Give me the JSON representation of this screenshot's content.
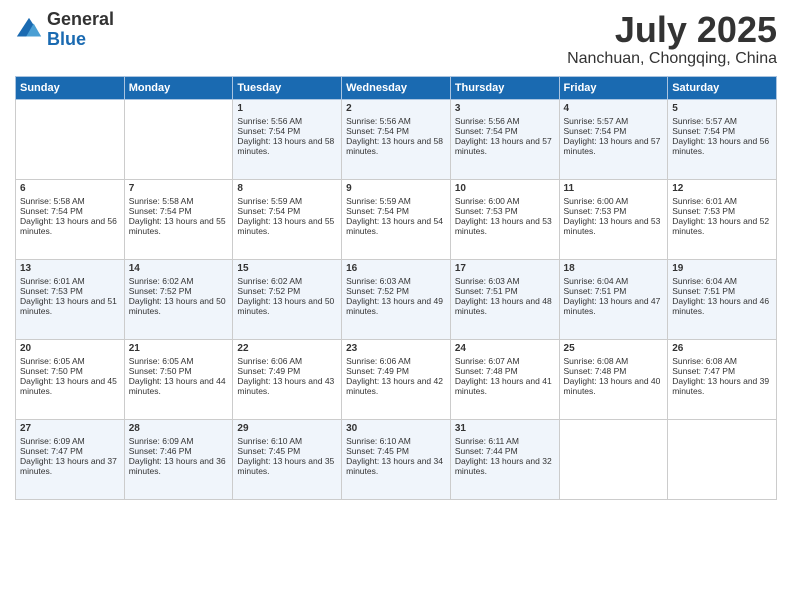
{
  "header": {
    "logo": {
      "general": "General",
      "blue": "Blue"
    },
    "title": "July 2025",
    "location": "Nanchuan, Chongqing, China"
  },
  "days_of_week": [
    "Sunday",
    "Monday",
    "Tuesday",
    "Wednesday",
    "Thursday",
    "Friday",
    "Saturday"
  ],
  "weeks": [
    [
      {
        "day": "",
        "empty": true
      },
      {
        "day": "",
        "empty": true
      },
      {
        "day": "1",
        "sunrise": "Sunrise: 5:56 AM",
        "sunset": "Sunset: 7:54 PM",
        "daylight": "Daylight: 13 hours and 58 minutes."
      },
      {
        "day": "2",
        "sunrise": "Sunrise: 5:56 AM",
        "sunset": "Sunset: 7:54 PM",
        "daylight": "Daylight: 13 hours and 58 minutes."
      },
      {
        "day": "3",
        "sunrise": "Sunrise: 5:56 AM",
        "sunset": "Sunset: 7:54 PM",
        "daylight": "Daylight: 13 hours and 57 minutes."
      },
      {
        "day": "4",
        "sunrise": "Sunrise: 5:57 AM",
        "sunset": "Sunset: 7:54 PM",
        "daylight": "Daylight: 13 hours and 57 minutes."
      },
      {
        "day": "5",
        "sunrise": "Sunrise: 5:57 AM",
        "sunset": "Sunset: 7:54 PM",
        "daylight": "Daylight: 13 hours and 56 minutes."
      }
    ],
    [
      {
        "day": "6",
        "sunrise": "Sunrise: 5:58 AM",
        "sunset": "Sunset: 7:54 PM",
        "daylight": "Daylight: 13 hours and 56 minutes."
      },
      {
        "day": "7",
        "sunrise": "Sunrise: 5:58 AM",
        "sunset": "Sunset: 7:54 PM",
        "daylight": "Daylight: 13 hours and 55 minutes."
      },
      {
        "day": "8",
        "sunrise": "Sunrise: 5:59 AM",
        "sunset": "Sunset: 7:54 PM",
        "daylight": "Daylight: 13 hours and 55 minutes."
      },
      {
        "day": "9",
        "sunrise": "Sunrise: 5:59 AM",
        "sunset": "Sunset: 7:54 PM",
        "daylight": "Daylight: 13 hours and 54 minutes."
      },
      {
        "day": "10",
        "sunrise": "Sunrise: 6:00 AM",
        "sunset": "Sunset: 7:53 PM",
        "daylight": "Daylight: 13 hours and 53 minutes."
      },
      {
        "day": "11",
        "sunrise": "Sunrise: 6:00 AM",
        "sunset": "Sunset: 7:53 PM",
        "daylight": "Daylight: 13 hours and 53 minutes."
      },
      {
        "day": "12",
        "sunrise": "Sunrise: 6:01 AM",
        "sunset": "Sunset: 7:53 PM",
        "daylight": "Daylight: 13 hours and 52 minutes."
      }
    ],
    [
      {
        "day": "13",
        "sunrise": "Sunrise: 6:01 AM",
        "sunset": "Sunset: 7:53 PM",
        "daylight": "Daylight: 13 hours and 51 minutes."
      },
      {
        "day": "14",
        "sunrise": "Sunrise: 6:02 AM",
        "sunset": "Sunset: 7:52 PM",
        "daylight": "Daylight: 13 hours and 50 minutes."
      },
      {
        "day": "15",
        "sunrise": "Sunrise: 6:02 AM",
        "sunset": "Sunset: 7:52 PM",
        "daylight": "Daylight: 13 hours and 50 minutes."
      },
      {
        "day": "16",
        "sunrise": "Sunrise: 6:03 AM",
        "sunset": "Sunset: 7:52 PM",
        "daylight": "Daylight: 13 hours and 49 minutes."
      },
      {
        "day": "17",
        "sunrise": "Sunrise: 6:03 AM",
        "sunset": "Sunset: 7:51 PM",
        "daylight": "Daylight: 13 hours and 48 minutes."
      },
      {
        "day": "18",
        "sunrise": "Sunrise: 6:04 AM",
        "sunset": "Sunset: 7:51 PM",
        "daylight": "Daylight: 13 hours and 47 minutes."
      },
      {
        "day": "19",
        "sunrise": "Sunrise: 6:04 AM",
        "sunset": "Sunset: 7:51 PM",
        "daylight": "Daylight: 13 hours and 46 minutes."
      }
    ],
    [
      {
        "day": "20",
        "sunrise": "Sunrise: 6:05 AM",
        "sunset": "Sunset: 7:50 PM",
        "daylight": "Daylight: 13 hours and 45 minutes."
      },
      {
        "day": "21",
        "sunrise": "Sunrise: 6:05 AM",
        "sunset": "Sunset: 7:50 PM",
        "daylight": "Daylight: 13 hours and 44 minutes."
      },
      {
        "day": "22",
        "sunrise": "Sunrise: 6:06 AM",
        "sunset": "Sunset: 7:49 PM",
        "daylight": "Daylight: 13 hours and 43 minutes."
      },
      {
        "day": "23",
        "sunrise": "Sunrise: 6:06 AM",
        "sunset": "Sunset: 7:49 PM",
        "daylight": "Daylight: 13 hours and 42 minutes."
      },
      {
        "day": "24",
        "sunrise": "Sunrise: 6:07 AM",
        "sunset": "Sunset: 7:48 PM",
        "daylight": "Daylight: 13 hours and 41 minutes."
      },
      {
        "day": "25",
        "sunrise": "Sunrise: 6:08 AM",
        "sunset": "Sunset: 7:48 PM",
        "daylight": "Daylight: 13 hours and 40 minutes."
      },
      {
        "day": "26",
        "sunrise": "Sunrise: 6:08 AM",
        "sunset": "Sunset: 7:47 PM",
        "daylight": "Daylight: 13 hours and 39 minutes."
      }
    ],
    [
      {
        "day": "27",
        "sunrise": "Sunrise: 6:09 AM",
        "sunset": "Sunset: 7:47 PM",
        "daylight": "Daylight: 13 hours and 37 minutes."
      },
      {
        "day": "28",
        "sunrise": "Sunrise: 6:09 AM",
        "sunset": "Sunset: 7:46 PM",
        "daylight": "Daylight: 13 hours and 36 minutes."
      },
      {
        "day": "29",
        "sunrise": "Sunrise: 6:10 AM",
        "sunset": "Sunset: 7:45 PM",
        "daylight": "Daylight: 13 hours and 35 minutes."
      },
      {
        "day": "30",
        "sunrise": "Sunrise: 6:10 AM",
        "sunset": "Sunset: 7:45 PM",
        "daylight": "Daylight: 13 hours and 34 minutes."
      },
      {
        "day": "31",
        "sunrise": "Sunrise: 6:11 AM",
        "sunset": "Sunset: 7:44 PM",
        "daylight": "Daylight: 13 hours and 32 minutes."
      },
      {
        "day": "",
        "empty": true
      },
      {
        "day": "",
        "empty": true
      }
    ]
  ]
}
